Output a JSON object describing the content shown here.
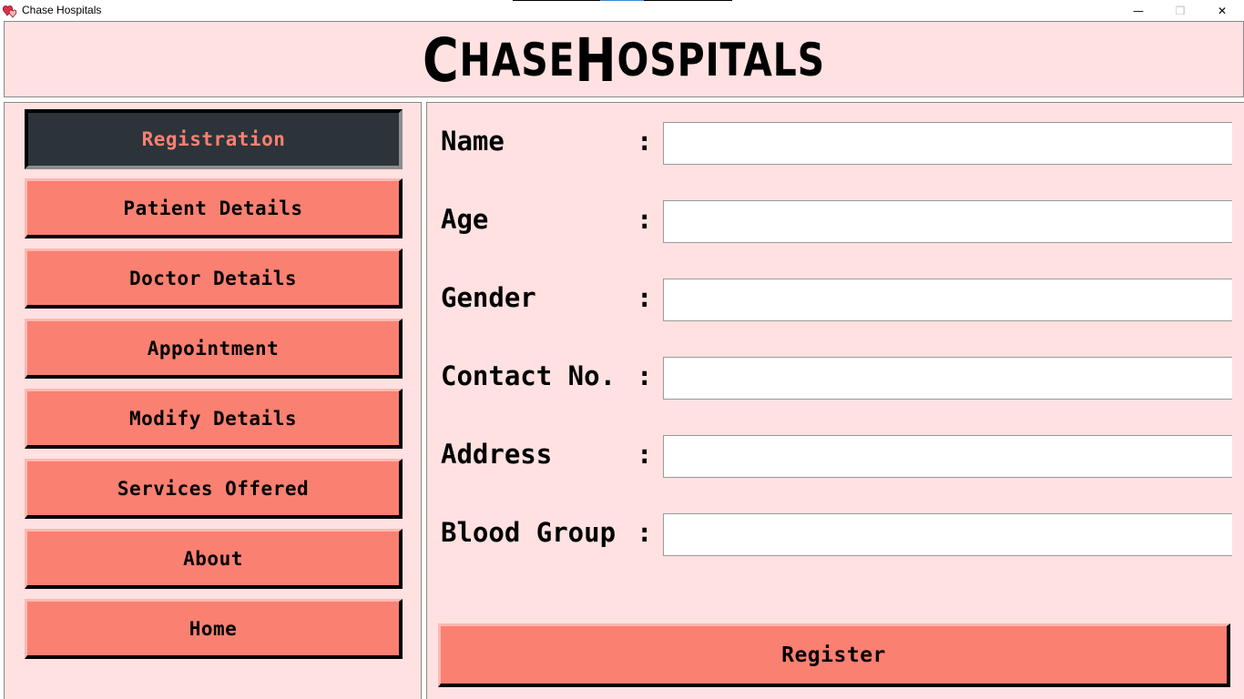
{
  "window": {
    "title": "Chase Hospitals",
    "minimize_label": "—",
    "maximize_label": "❐",
    "close_label": "✕",
    "icon": "hearts-icon"
  },
  "header": {
    "title_initial_1": "C",
    "title_rest_1": "HASE ",
    "title_initial_2": "H",
    "title_rest_2": "OSPITALS"
  },
  "sidebar": {
    "items": [
      {
        "label": "Registration",
        "active": true
      },
      {
        "label": "Patient Details",
        "active": false
      },
      {
        "label": "Doctor Details",
        "active": false
      },
      {
        "label": "Appointment",
        "active": false
      },
      {
        "label": "Modify Details",
        "active": false
      },
      {
        "label": "Services Offered",
        "active": false
      },
      {
        "label": "About",
        "active": false
      },
      {
        "label": "Home",
        "active": false
      }
    ]
  },
  "form": {
    "fields": [
      {
        "label": "Name",
        "colon": ":",
        "value": ""
      },
      {
        "label": "Age",
        "colon": ":",
        "value": ""
      },
      {
        "label": "Gender",
        "colon": ":",
        "value": ""
      },
      {
        "label": "Contact No.",
        "colon": ":",
        "value": ""
      },
      {
        "label": "Address",
        "colon": ":",
        "value": ""
      },
      {
        "label": "Blood Group",
        "colon": ":",
        "value": ""
      }
    ],
    "submit_label": "Register"
  },
  "colors": {
    "background": "#ffe1e1",
    "button": "#fa8072",
    "active_button_bg": "#2c343a",
    "active_button_text": "#fa8072"
  }
}
